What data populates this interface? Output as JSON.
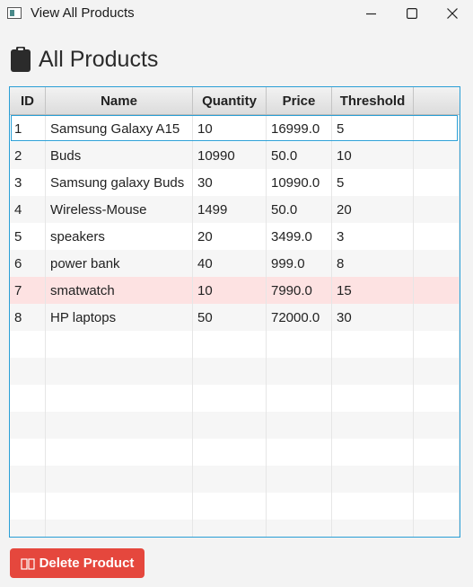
{
  "window": {
    "title": "View All Products",
    "icon": "app-window-icon"
  },
  "header": {
    "icon": "clipboard-icon",
    "title": "All Products"
  },
  "table": {
    "columns": [
      "ID",
      "Name",
      "Quantity",
      "Price",
      "Threshold"
    ],
    "rows": [
      {
        "id": "1",
        "name": "Samsung Galaxy A15",
        "quantity": "10",
        "price": "16999.0",
        "threshold": "5"
      },
      {
        "id": "2",
        "name": "Buds",
        "quantity": "10990",
        "price": "50.0",
        "threshold": "10"
      },
      {
        "id": "3",
        "name": "Samsung galaxy Buds",
        "quantity": "30",
        "price": "10990.0",
        "threshold": "5"
      },
      {
        "id": "4",
        "name": "Wireless-Mouse",
        "quantity": "1499",
        "price": "50.0",
        "threshold": "20"
      },
      {
        "id": "5",
        "name": "speakers",
        "quantity": "20",
        "price": "3499.0",
        "threshold": "3"
      },
      {
        "id": "6",
        "name": "power bank",
        "quantity": "40",
        "price": "999.0",
        "threshold": "8"
      },
      {
        "id": "7",
        "name": "smatwatch",
        "quantity": "10",
        "price": "7990.0",
        "threshold": "15"
      },
      {
        "id": "8",
        "name": "HP laptops",
        "quantity": "50",
        "price": "72000.0",
        "threshold": "30"
      }
    ],
    "selected_row_index": 0,
    "highlighted_row_indices": [
      6
    ],
    "accent_color": "#2a9fd6",
    "highlight_color": "#fde2e2"
  },
  "actions": {
    "delete_label": "Delete Product",
    "delete_icon": "trash-icon",
    "delete_color": "#e5473d"
  }
}
